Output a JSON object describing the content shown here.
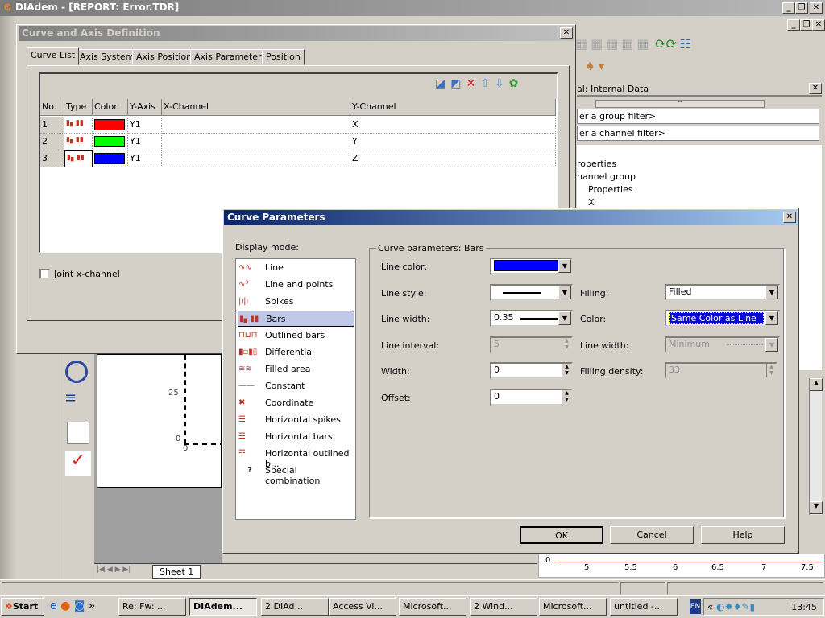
{
  "app": {
    "title": "DIAdem - [REPORT:  Error.TDR]"
  },
  "curve_axis_dialog": {
    "title": "Curve and Axis Definition",
    "tabs": [
      "Curve List",
      "Axis System",
      "Axis Position",
      "Axis Parameters",
      "Position"
    ],
    "columns": [
      "No.",
      "Type",
      "Color",
      "Y-Axis",
      "X-Channel",
      "Y-Channel"
    ],
    "rows": [
      {
        "no": "1",
        "color": "#ff0000",
        "y_axis": "Y1",
        "x_channel": "",
        "y_channel": "X"
      },
      {
        "no": "2",
        "color": "#00ff00",
        "y_axis": "Y1",
        "x_channel": "",
        "y_channel": "Y"
      },
      {
        "no": "3",
        "color": "#0000ff",
        "y_axis": "Y1",
        "x_channel": "",
        "y_channel": "Z"
      }
    ],
    "joint_x_channel": "Joint x-channel",
    "joint_x_checked": false
  },
  "data_portal": {
    "title": "al: Internal Data",
    "group_filter": "er a group filter>",
    "channel_filter": "er a channel filter>",
    "tree": [
      "roperties",
      "hannel group",
      "Properties",
      "X"
    ]
  },
  "curve_params": {
    "title": "Curve Parameters",
    "display_mode_label": "Display mode:",
    "modes": [
      "Line",
      "Line and points",
      "Spikes",
      "Bars",
      "Outlined bars",
      "Differential",
      "Filled area",
      "Constant",
      "Coordinate",
      "Horizontal spikes",
      "Horizontal bars",
      "Horizontal outlined b...",
      "Special combination"
    ],
    "selected_mode": "Bars",
    "group_title": "Curve parameters: Bars",
    "line_color_label": "Line color:",
    "line_color": "#0000ff",
    "line_style_label": "Line style:",
    "line_width_label": "Line width:",
    "line_width": "0.35",
    "line_interval_label": "Line interval:",
    "line_interval": "5",
    "width_label": "Width:",
    "width": "0",
    "offset_label": "Offset:",
    "offset": "0",
    "filling_label": "Filling:",
    "filling": "Filled",
    "color_label": "Color:",
    "color": "Same Color as Line",
    "fill_line_width_label": "Line width:",
    "fill_line_width": "Minimum",
    "filling_density_label": "Filling density:",
    "filling_density": "33",
    "ok": "OK",
    "cancel": "Cancel",
    "help": "Help"
  },
  "report": {
    "y_tick_25": "25",
    "y_tick_0": "0",
    "x_tick_0": "0",
    "sheet_tab": "Sheet 1"
  },
  "mini_chart": {
    "y0": "0",
    "x_ticks": [
      "5",
      "5.5",
      "6",
      "6.5",
      "7",
      "7.5"
    ]
  },
  "taskbar": {
    "start": "Start",
    "items": [
      "Re: Fw: ...",
      "DIAdem...",
      "2 DIAd...",
      "Access Vi...",
      "Microsoft...",
      "2 Wind...",
      "Microsoft...",
      "untitled -..."
    ],
    "lang": "EN",
    "clock": "13:45"
  }
}
